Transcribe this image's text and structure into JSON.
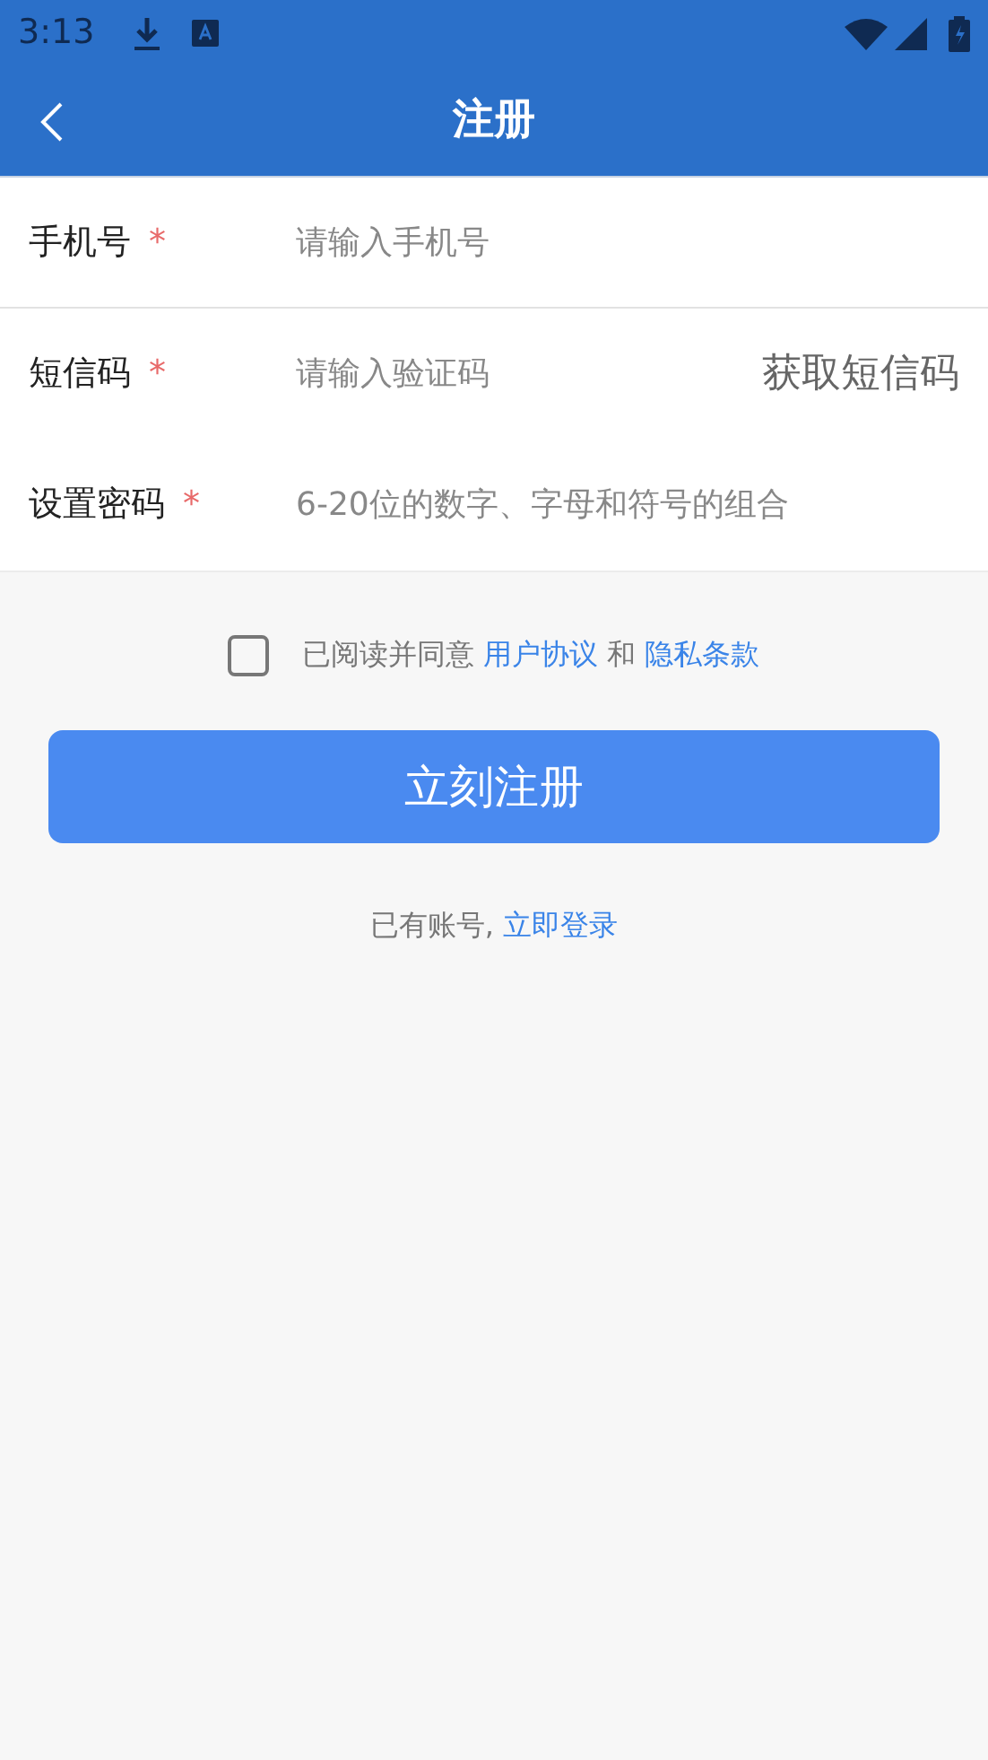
{
  "status_bar": {
    "time": "3:13"
  },
  "header": {
    "title": "注册"
  },
  "fields": [
    {
      "kind": "phone",
      "label": "手机号",
      "required_mark": "*",
      "placeholder": "请输入手机号"
    },
    {
      "kind": "code",
      "label": "短信码",
      "required_mark": "*",
      "placeholder": "请输入验证码",
      "action": "获取短信码"
    },
    {
      "kind": "password",
      "label": "设置密码",
      "required_mark": "*",
      "placeholder": "6-20位的数字、字母和符号的组合"
    }
  ],
  "agreement": {
    "checked": false,
    "text": "已阅读并同意",
    "link_1": "用户协议",
    "joiner": "和",
    "link_2": "隐私条款"
  },
  "submit_button": "立刻注册",
  "login_prompt": {
    "text": "已有账号,",
    "link": "立即登录"
  }
}
